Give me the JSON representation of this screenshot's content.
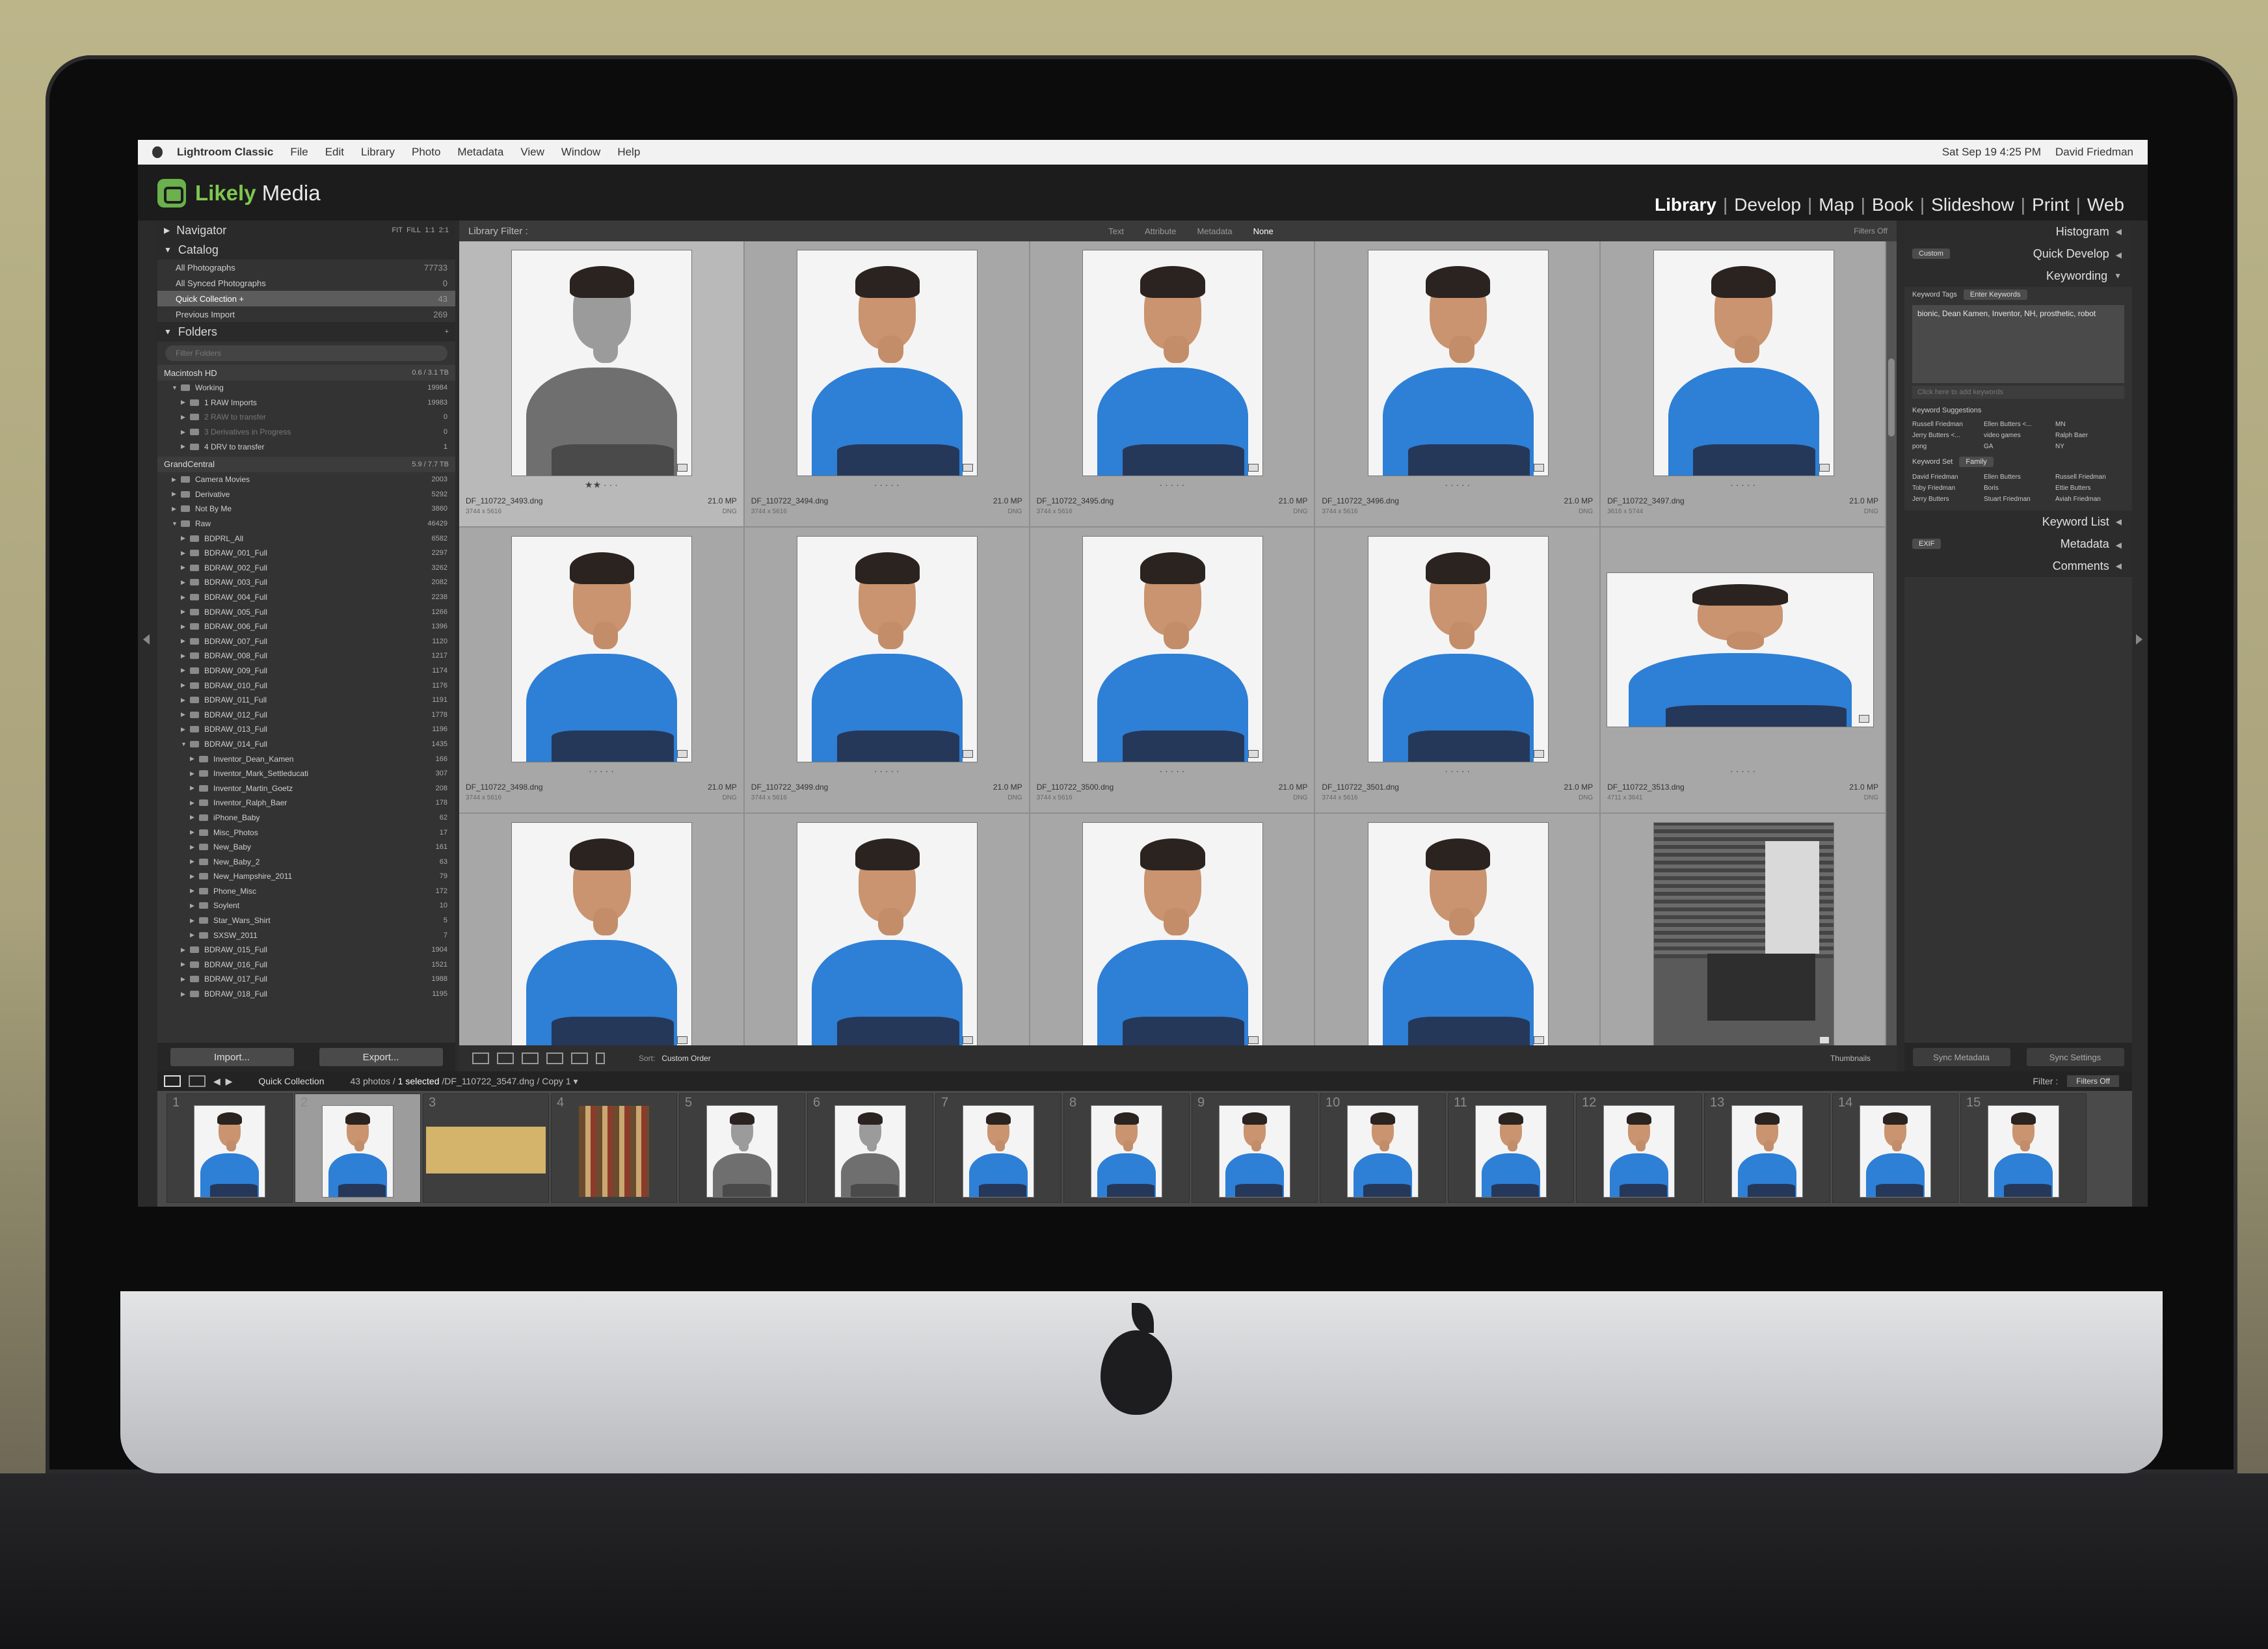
{
  "menubar": {
    "app_name": "Lightroom Classic",
    "items": [
      "File",
      "Edit",
      "Library",
      "Photo",
      "Metadata",
      "View",
      "Window",
      "Help"
    ],
    "clock": "Sat Sep 19  4:25 PM",
    "user": "David Friedman"
  },
  "brand": {
    "name_a": "Likely",
    "name_b": " Media"
  },
  "modules": [
    "Library",
    "Develop",
    "Map",
    "Book",
    "Slideshow",
    "Print",
    "Web"
  ],
  "left": {
    "navigator": {
      "label": "Navigator",
      "zoom": [
        "FIT",
        "FILL",
        "1:1",
        "2:1"
      ]
    },
    "catalog": {
      "label": "Catalog",
      "rows": [
        {
          "name": "All Photographs",
          "count": "77733"
        },
        {
          "name": "All Synced Photographs",
          "count": "0"
        },
        {
          "name": "Quick Collection +",
          "count": "43"
        },
        {
          "name": "Previous Import",
          "count": "269"
        }
      ]
    },
    "folders": {
      "label": "Folders",
      "filter_placeholder": "Filter Folders",
      "volumes": [
        {
          "name": "Macintosh HD",
          "info": "0.6 / 3.1 TB"
        },
        {
          "name": "GrandCentral",
          "info": "5.9 / 7.7 TB"
        }
      ],
      "mac_items": [
        {
          "name": "Working",
          "count": "19984",
          "depth": 1,
          "open": true
        },
        {
          "name": "1 RAW Imports",
          "count": "19983",
          "depth": 2,
          "open": false
        },
        {
          "name": "2 RAW to transfer",
          "count": "0",
          "depth": 2,
          "open": false
        },
        {
          "name": "3 Derivatives in Progress",
          "count": "0",
          "depth": 2,
          "open": false
        },
        {
          "name": "4 DRV to transfer",
          "count": "1",
          "depth": 2,
          "open": false
        }
      ],
      "gc_items": [
        {
          "name": "Camera Movies",
          "count": "2003",
          "depth": 1
        },
        {
          "name": "Derivative",
          "count": "5292",
          "depth": 1
        },
        {
          "name": "Not By Me",
          "count": "3860",
          "depth": 1
        },
        {
          "name": "Raw",
          "count": "46429",
          "depth": 1,
          "open": true
        },
        {
          "name": "BDPRL_All",
          "count": "6582",
          "depth": 2
        },
        {
          "name": "BDRAW_001_Full",
          "count": "2297",
          "depth": 2
        },
        {
          "name": "BDRAW_002_Full",
          "count": "3262",
          "depth": 2
        },
        {
          "name": "BDRAW_003_Full",
          "count": "2082",
          "depth": 2
        },
        {
          "name": "BDRAW_004_Full",
          "count": "2238",
          "depth": 2
        },
        {
          "name": "BDRAW_005_Full",
          "count": "1266",
          "depth": 2
        },
        {
          "name": "BDRAW_006_Full",
          "count": "1396",
          "depth": 2
        },
        {
          "name": "BDRAW_007_Full",
          "count": "1120",
          "depth": 2
        },
        {
          "name": "BDRAW_008_Full",
          "count": "1217",
          "depth": 2
        },
        {
          "name": "BDRAW_009_Full",
          "count": "1174",
          "depth": 2
        },
        {
          "name": "BDRAW_010_Full",
          "count": "1176",
          "depth": 2
        },
        {
          "name": "BDRAW_011_Full",
          "count": "1191",
          "depth": 2
        },
        {
          "name": "BDRAW_012_Full",
          "count": "1778",
          "depth": 2
        },
        {
          "name": "BDRAW_013_Full",
          "count": "1196",
          "depth": 2
        },
        {
          "name": "BDRAW_014_Full",
          "count": "1435",
          "depth": 2,
          "open": true
        },
        {
          "name": "Inventor_Dean_Kamen",
          "count": "166",
          "depth": 3
        },
        {
          "name": "Inventor_Mark_Settleducati",
          "count": "307",
          "depth": 3
        },
        {
          "name": "Inventor_Martin_Goetz",
          "count": "208",
          "depth": 3
        },
        {
          "name": "Inventor_Ralph_Baer",
          "count": "178",
          "depth": 3
        },
        {
          "name": "iPhone_Baby",
          "count": "62",
          "depth": 3
        },
        {
          "name": "Misc_Photos",
          "count": "17",
          "depth": 3
        },
        {
          "name": "New_Baby",
          "count": "161",
          "depth": 3
        },
        {
          "name": "New_Baby_2",
          "count": "63",
          "depth": 3
        },
        {
          "name": "New_Hampshire_2011",
          "count": "79",
          "depth": 3
        },
        {
          "name": "Phone_Misc",
          "count": "172",
          "depth": 3
        },
        {
          "name": "Soylent",
          "count": "10",
          "depth": 3
        },
        {
          "name": "Star_Wars_Shirt",
          "count": "5",
          "depth": 3
        },
        {
          "name": "SXSW_2011",
          "count": "7",
          "depth": 3
        },
        {
          "name": "BDRAW_015_Full",
          "count": "1904",
          "depth": 2
        },
        {
          "name": "BDRAW_016_Full",
          "count": "1521",
          "depth": 2
        },
        {
          "name": "BDRAW_017_Full",
          "count": "1988",
          "depth": 2
        },
        {
          "name": "BDRAW_018_Full",
          "count": "1195",
          "depth": 2
        }
      ]
    },
    "import_label": "Import...",
    "export_label": "Export..."
  },
  "center": {
    "filter_label": "Library Filter :",
    "filter_tabs": [
      "Text",
      "Attribute",
      "Metadata",
      "None"
    ],
    "filters_off": "Filters Off",
    "rows": [
      [
        {
          "file": "DF_110722_3493.dng",
          "dims": "3744 x 5616",
          "mp": "21.0 MP",
          "type": "DNG",
          "style": "gray",
          "stars": "★★ · · ·"
        },
        {
          "file": "DF_110722_3494.dng",
          "dims": "3744 x 5616",
          "mp": "21.0 MP",
          "type": "DNG",
          "style": "color",
          "stars": "· · · · ·"
        },
        {
          "file": "DF_110722_3495.dng",
          "dims": "3744 x 5616",
          "mp": "21.0 MP",
          "type": "DNG",
          "style": "color",
          "stars": "· · · · ·"
        },
        {
          "file": "DF_110722_3496.dng",
          "dims": "3744 x 5616",
          "mp": "21.0 MP",
          "type": "DNG",
          "style": "color",
          "stars": "· · · · ·"
        },
        {
          "file": "DF_110722_3497.dng",
          "dims": "3616 x 5744",
          "mp": "21.0 MP",
          "type": "DNG",
          "style": "color",
          "stars": "· · · · ·"
        }
      ],
      [
        {
          "file": "DF_110722_3498.dng",
          "dims": "3744 x 5616",
          "mp": "21.0 MP",
          "type": "DNG",
          "style": "color",
          "stars": "· · · · ·"
        },
        {
          "file": "DF_110722_3499.dng",
          "dims": "3744 x 5616",
          "mp": "21.0 MP",
          "type": "DNG",
          "style": "color",
          "stars": "· · · · ·"
        },
        {
          "file": "DF_110722_3500.dng",
          "dims": "3744 x 5616",
          "mp": "21.0 MP",
          "type": "DNG",
          "style": "color",
          "stars": "· · · · ·"
        },
        {
          "file": "DF_110722_3501.dng",
          "dims": "3744 x 5616",
          "mp": "21.0 MP",
          "type": "DNG",
          "style": "color",
          "stars": "· · · · ·"
        },
        {
          "file": "DF_110722_3513.dng",
          "dims": "4711 x 3641",
          "mp": "21.0 MP",
          "type": "DNG",
          "style": "landscape",
          "stars": "· · · · ·"
        }
      ],
      [
        {
          "style": "color"
        },
        {
          "style": "color"
        },
        {
          "style": "color"
        },
        {
          "style": "color"
        },
        {
          "style": "office"
        }
      ]
    ],
    "sort_label": "Sort:",
    "sort_value": "Custom Order",
    "thumbnails_label": "Thumbnails"
  },
  "right": {
    "histogram": "Histogram",
    "quick_develop": "Quick Develop",
    "qd_preset": "Custom",
    "keywording": "Keywording",
    "keyword_tags_label": "Keyword Tags",
    "keyword_tags_mode": "Enter Keywords",
    "keywords": "bionic, Dean Kamen, Inventor, NH, prosthetic, robot",
    "add_keywords_placeholder": "Click here to add keywords",
    "suggestions_label": "Keyword Suggestions",
    "suggestions": [
      "Russell Friedman",
      "Ellen Butters <...",
      "MN",
      "Jerry Butters <...",
      "video games",
      "Ralph Baer",
      "pong",
      "GA",
      "NY"
    ],
    "keyword_set_label": "Keyword Set",
    "keyword_set_value": "Family",
    "keyword_set": [
      "David Friedman",
      "Ellen Butters",
      "Russell Friedman",
      "Toby Friedman",
      "Boris",
      "Ettie Butters",
      "Jerry Butters",
      "Stuart Friedman",
      "Aviah Friedman"
    ],
    "keyword_list": "Keyword List",
    "metadata": "Metadata",
    "metadata_preset": "EXIF",
    "comments": "Comments",
    "sync_metadata": "Sync Metadata",
    "sync_settings": "Sync Settings"
  },
  "filmstrip": {
    "source": "Quick Collection",
    "summary": "43 photos / ",
    "selected": "1 selected",
    "path": " /DF_110722_3547.dng / Copy 1 ▾",
    "filter_label": "Filter :",
    "filters_off": "Filters Off",
    "numbers": [
      "1",
      "2",
      "3",
      "4",
      "5",
      "6",
      "7",
      "8",
      "9",
      "10",
      "11",
      "12",
      "13",
      "14",
      "15"
    ],
    "styles": [
      "color",
      "color",
      "wide",
      "books",
      "gray",
      "gray",
      "color",
      "color",
      "color",
      "color",
      "color",
      "color",
      "color",
      "color",
      "color"
    ]
  },
  "colors": {
    "shirt": "#2e7fd6",
    "brand_green": "#7ec850"
  }
}
